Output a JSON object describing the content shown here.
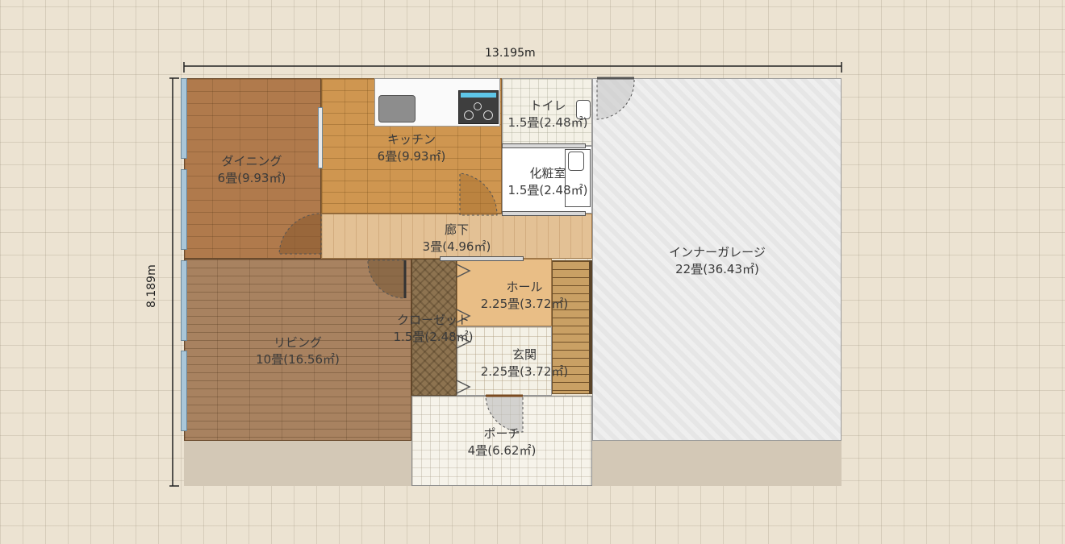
{
  "dimensions": {
    "width_label": "13.195m",
    "height_label": "8.189m"
  },
  "rooms": {
    "dining": {
      "name": "ダイニング",
      "area": "6畳(9.93㎡)"
    },
    "kitchen": {
      "name": "キッチン",
      "area": "6畳(9.93㎡)"
    },
    "toilet": {
      "name": "トイレ",
      "area": "1.5畳(2.48㎡)"
    },
    "powder": {
      "name": "化粧室",
      "area": "1.5畳(2.48㎡)"
    },
    "corridor": {
      "name": "廊下",
      "area": "3畳(4.96㎡)"
    },
    "garage": {
      "name": "インナーガレージ",
      "area": "22畳(36.43㎡)"
    },
    "hall": {
      "name": "ホール",
      "area": "2.25畳(3.72㎡)"
    },
    "closet": {
      "name": "クローゼット",
      "area": "1.5畳(2.48㎡)"
    },
    "living": {
      "name": "リビング",
      "area": "10畳(16.56㎡)"
    },
    "entrance": {
      "name": "玄関",
      "area": "2.25畳(3.72㎡)"
    },
    "porch": {
      "name": "ポーチ",
      "area": "4畳(6.62㎡)"
    }
  },
  "colors": {
    "dining": "#b07a4c",
    "kitchen": "#cf9650",
    "corridor": "#e3c195",
    "living": "#a88260",
    "closet": "#8d7350",
    "hall": "#e9be86",
    "garage": "#e6e6e6",
    "tile": "#f4f1e6"
  }
}
